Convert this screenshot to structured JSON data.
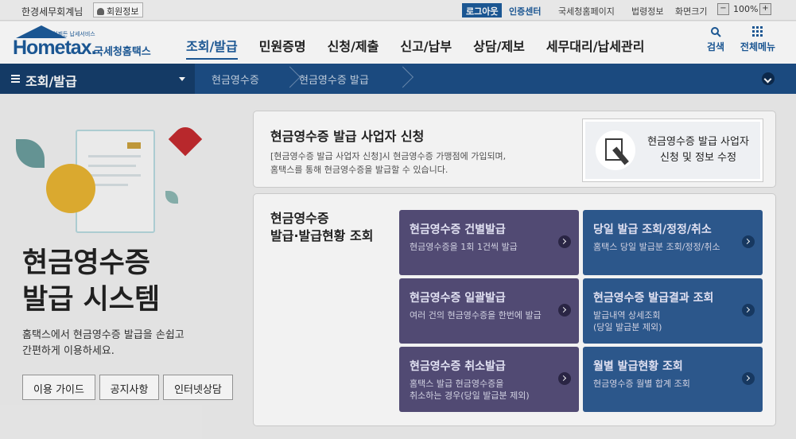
{
  "topbar": {
    "user_name": "한경세무회계님",
    "member_info": "회원정보",
    "logout": "로그아웃",
    "cert_center": "인증센터",
    "links": [
      "국세청홈페이지",
      "법령정보",
      "화면크기"
    ],
    "zoom_minus": "−",
    "zoom_value": "100%",
    "zoom_plus": "+"
  },
  "header": {
    "logo_text": "Hometax.",
    "logo_subtext": "언제든 납세서비스",
    "logo_korean": "국세청홈택스",
    "gnb": [
      "조회/발급",
      "민원증명",
      "신청/제출",
      "신고/납부",
      "상담/제보",
      "세무대리/납세관리"
    ],
    "search_label": "검색",
    "allmenu_label": "전체메뉴"
  },
  "navbar": {
    "section": "조회/발급",
    "crumbs": [
      "현금영수증",
      "현금영수증 발급"
    ]
  },
  "hero": {
    "title_line1": "현금영수증",
    "title_line2": "발급 시스템",
    "desc_line1": "홈택스에서 현금영수증 발급을 손쉽고",
    "desc_line2": "간편하게 이용하세요.",
    "buttons": [
      "이용 가이드",
      "공지사항",
      "인터넷상담"
    ]
  },
  "apply_box": {
    "title": "현금영수증 발급 사업자 신청",
    "desc_line1": "[현금영수증 발급 사업자 신청]시 현금영수증 가맹점에 가입되며,",
    "desc_line2": "홈택스를 통해 현금영수증을 발급할 수 있습니다.",
    "cta_line1": "현금영수증 발급 사업자",
    "cta_line2": "신청 및 정보 수정"
  },
  "issue_box": {
    "title_line1": "현금영수증",
    "title_line2": "발급·발급현황 조회",
    "tiles": [
      {
        "title": "현금영수증 건별발급",
        "desc1": "현금영수증을 1회 1건씩 발급",
        "desc2": ""
      },
      {
        "title": "당일 발급 조회/정정/취소",
        "desc1": "홈택스 당일 발급분 조회/정정/취소",
        "desc2": ""
      },
      {
        "title": "현금영수증 일괄발급",
        "desc1": "여러 건의 현금영수증을 한번에 발급",
        "desc2": ""
      },
      {
        "title": "현금영수증 발급결과 조회",
        "desc1": "발급내역 상세조회",
        "desc2": "(당일 발급분 제외)"
      },
      {
        "title": "현금영수증 취소발급",
        "desc1": "홈택스 발급 현금영수증을",
        "desc2": "취소하는 경우(당일 발급분 제외)"
      },
      {
        "title": "월별 발급현황 조회",
        "desc1": "현금영수증 월별 합계 조회",
        "desc2": ""
      }
    ]
  },
  "colors": {
    "brand": "#1d5b9a",
    "tile_purple": "#564f7a",
    "tile_blue": "#2f5c93",
    "nav": "#1d4f86"
  }
}
